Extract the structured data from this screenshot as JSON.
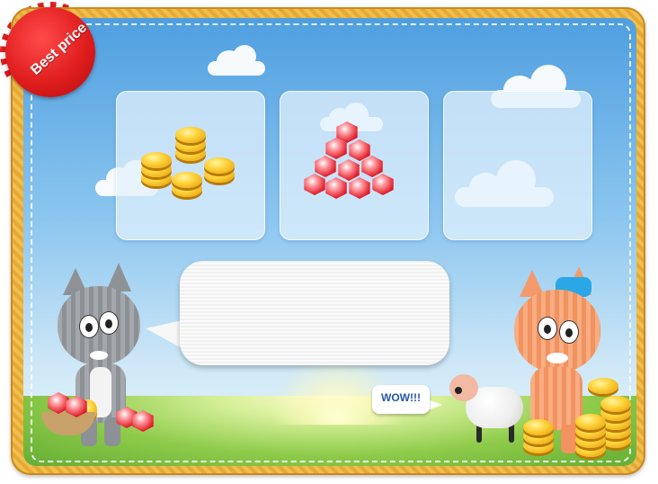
{
  "badge": {
    "label": "Best price"
  },
  "offers": [
    {
      "item": "coins",
      "icon": "gold-coins-icon"
    },
    {
      "item": "rubies",
      "icon": "red-gems-icon"
    },
    {
      "item": "empty",
      "icon": ""
    }
  ],
  "speech_bubble": {
    "text": ""
  },
  "sheep_bubble": {
    "text": "WOW!!!"
  },
  "colors": {
    "badge": "#e01e1e",
    "wow_text": "#2458a6",
    "frame": "#e6a936",
    "sky": "#6bb6ea"
  }
}
